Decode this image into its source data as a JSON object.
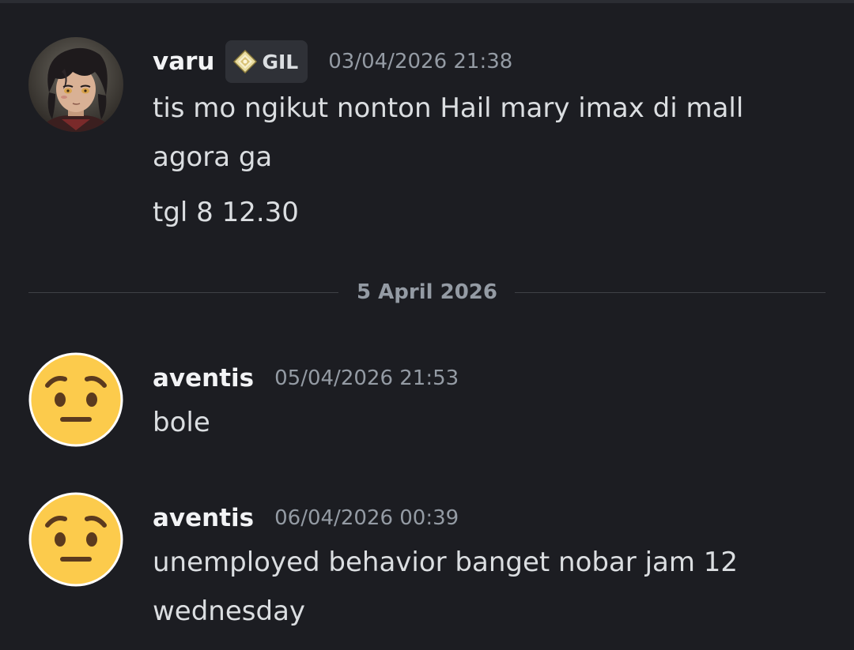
{
  "messages": [
    {
      "username": "varu",
      "tag": {
        "label": "GIL",
        "icon": "diamond-clan-icon"
      },
      "timestamp": "03/04/2026 21:38",
      "lines": [
        "tis mo ngikut nonton Hail mary imax di mall",
        "agora ga",
        "tgl 8 12.30"
      ],
      "avatar": "anime-character-avatar"
    },
    {
      "username": "aventis",
      "timestamp": "05/04/2026 21:53",
      "lines": [
        "bole"
      ],
      "avatar": "worried-face-emoji-avatar"
    },
    {
      "username": "aventis",
      "timestamp": "06/04/2026 00:39",
      "lines": [
        "unemployed behavior banget nobar jam 12",
        "wednesday"
      ],
      "avatar": "worried-face-emoji-avatar"
    }
  ],
  "date_divider": "5 April 2026",
  "colors": {
    "background": "#1c1d22",
    "username": "#f2f3f5",
    "text": "#dbdee1",
    "muted": "#949ba4",
    "emoji_yellow": "#fccb4c"
  }
}
